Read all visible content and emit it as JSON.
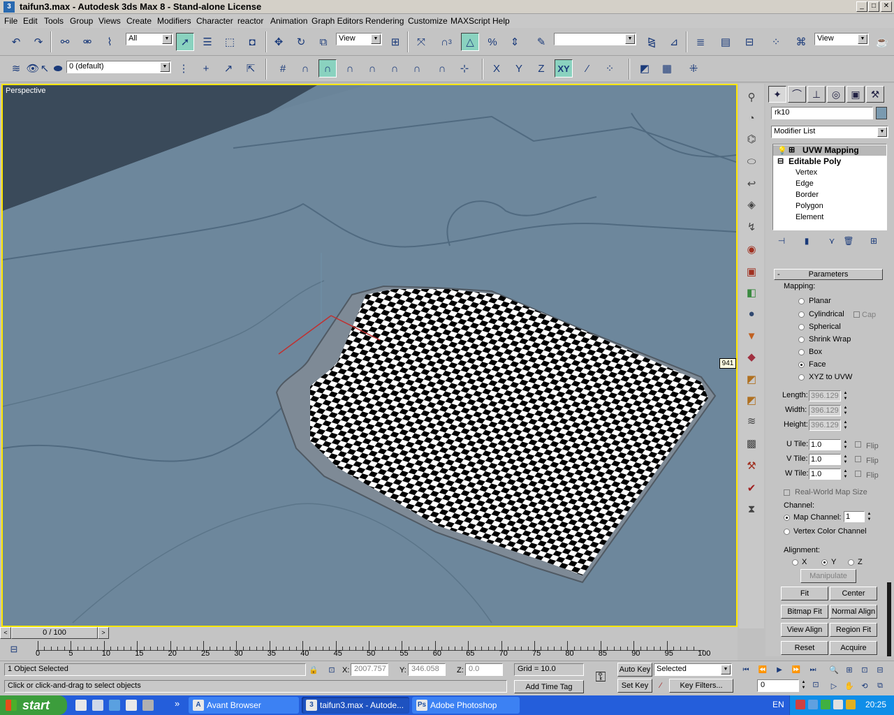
{
  "window": {
    "title": "taifun3.max - Autodesk 3ds Max 8  - Stand-alone License",
    "min": "_",
    "max": "□",
    "close": "✕"
  },
  "menu": [
    "File",
    "Edit",
    "Tools",
    "Group",
    "Views",
    "Create",
    "Modifiers",
    "Character",
    "reactor",
    "Animation",
    "Graph Editors",
    "Rendering",
    "Customize",
    "MAXScript",
    "Help"
  ],
  "toolbar": {
    "selection_filter": "All",
    "reference_coord": "View",
    "named_selection": "",
    "view2": "View",
    "degree_label": "3",
    "percent_label": "%"
  },
  "layers": {
    "current": "0 (default)"
  },
  "axis": {
    "x": "X",
    "y": "Y",
    "z": "Z",
    "xy": "XY"
  },
  "viewport": {
    "label": "Perspective",
    "badge": "941"
  },
  "command_panel": {
    "object_name": "rk10",
    "modifier_list": "Modifier List",
    "stack": {
      "uvw": "UVW Mapping",
      "poly": "Editable Poly",
      "subs": [
        "Vertex",
        "Edge",
        "Border",
        "Polygon",
        "Element"
      ]
    },
    "rollout": "Parameters",
    "mapping_label": "Mapping:",
    "mapping": [
      "Planar",
      "Cylindrical",
      "Spherical",
      "Shrink Wrap",
      "Box",
      "Face",
      "XYZ to UVW"
    ],
    "mapping_selected": "Face",
    "cap": "Cap",
    "length_label": "Length:",
    "length": "396.129",
    "width_label": "Width:",
    "width": "396.129",
    "height_label": "Height:",
    "height": "396.129",
    "utile_label": "U Tile:",
    "utile": "1.0",
    "vtile_label": "V Tile:",
    "vtile": "1.0",
    "wtile_label": "W Tile:",
    "wtile": "1.0",
    "flip": "Flip",
    "realworld": "Real-World Map Size",
    "channel_label": "Channel:",
    "map_channel": "Map Channel:",
    "map_channel_value": "1",
    "vertex_color": "Vertex Color Channel",
    "alignment_label": "Alignment:",
    "align_x": "X",
    "align_y": "Y",
    "align_z": "Z",
    "manipulate": "Manipulate",
    "buttons": [
      "Fit",
      "Center",
      "Bitmap Fit",
      "Normal Align",
      "View Align",
      "Region Fit",
      "Reset",
      "Acquire"
    ]
  },
  "timeslider": "0 / 100",
  "ticks": [
    "0",
    "5",
    "10",
    "15",
    "20",
    "25",
    "30",
    "35",
    "40",
    "45",
    "50",
    "55",
    "60",
    "65",
    "70",
    "75",
    "80",
    "85",
    "90",
    "95",
    "100"
  ],
  "status": {
    "selected": "1 Object Selected",
    "prompt": "Click or click-and-drag to select objects",
    "x_label": "X:",
    "x": "2007.757",
    "y_label": "Y:",
    "y": "346.058",
    "z_label": "Z:",
    "z": "0.0",
    "grid": "Grid = 10.0",
    "add_time_tag": "Add Time Tag",
    "auto_key": "Auto Key",
    "set_key": "Set Key",
    "selected_dd": "Selected",
    "key_filters": "Key Filters...",
    "frame": "0"
  },
  "taskbar": {
    "start": "start",
    "tasks": [
      "Avant Browser",
      "taifun3.max - Autode...",
      "Adobe Photoshop"
    ],
    "lang": "EN",
    "time": "20:25"
  }
}
